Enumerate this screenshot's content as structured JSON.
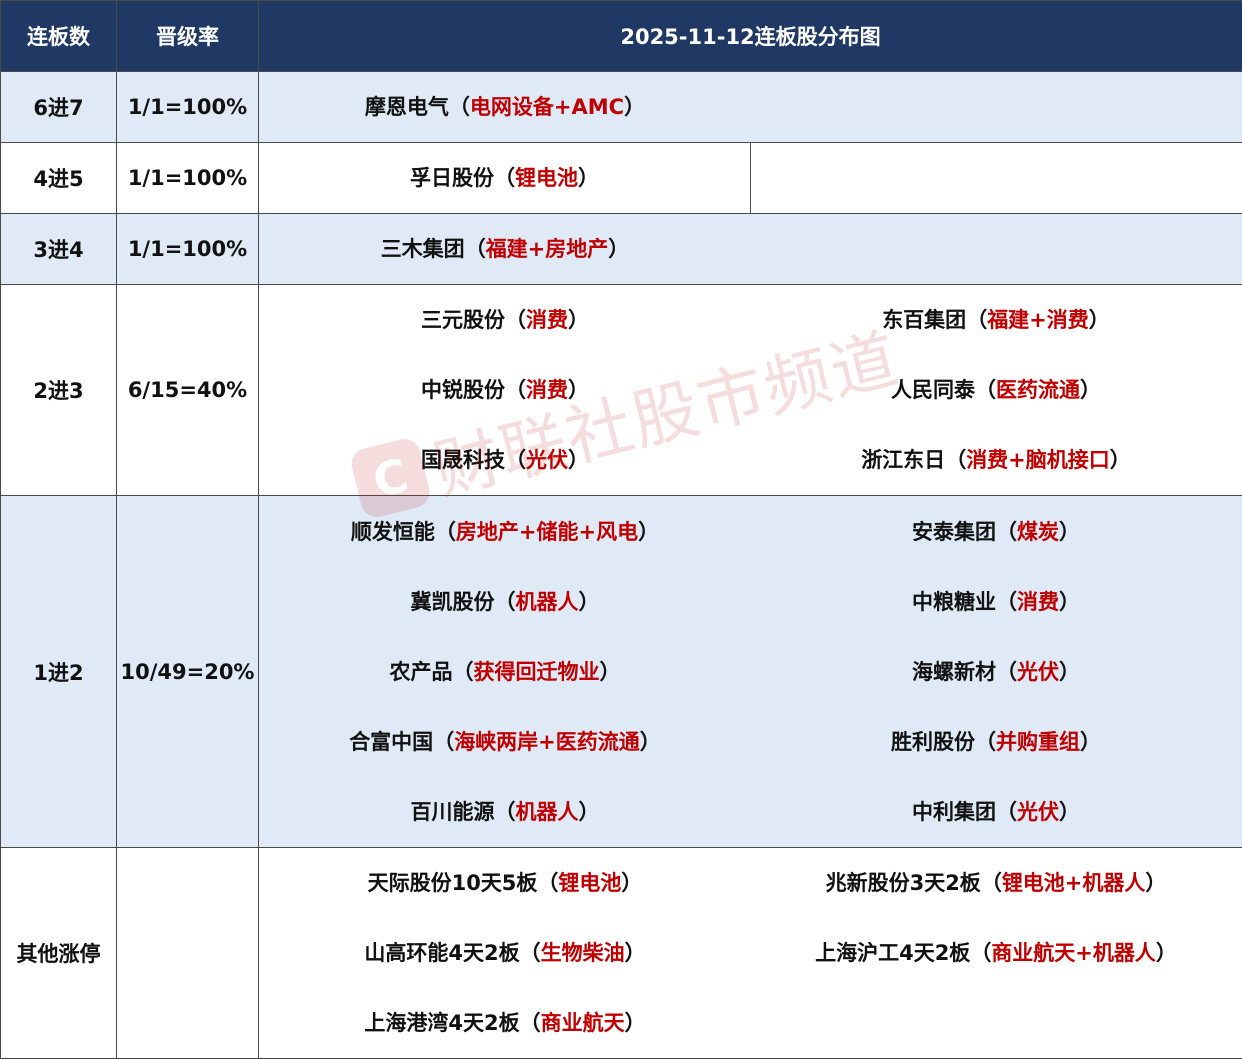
{
  "header": {
    "col_level": "连板数",
    "col_rate": "晋级率",
    "title": "2025-11-12连板股分布图"
  },
  "rows": [
    {
      "level": "6进7",
      "rate": "1/1=100%",
      "stocks": [
        {
          "name": "摩恩电气",
          "theme": "电网设备+AMC"
        }
      ]
    },
    {
      "level": "4进5",
      "rate": "1/1=100%",
      "stocks": [
        {
          "name": "孚日股份",
          "theme": "锂电池"
        }
      ]
    },
    {
      "level": "3进4",
      "rate": "1/1=100%",
      "stocks": [
        {
          "name": "三木集团",
          "theme": "福建+房地产"
        }
      ]
    },
    {
      "level": "2进3",
      "rate": "6/15=40%",
      "stocks": [
        {
          "name": "三元股份",
          "theme": "消费"
        },
        {
          "name": "东百集团",
          "theme": "福建+消费"
        },
        {
          "name": "中锐股份",
          "theme": "消费"
        },
        {
          "name": "人民同泰",
          "theme": "医药流通"
        },
        {
          "name": "国晟科技",
          "theme": "光伏"
        },
        {
          "name": "浙江东日",
          "theme": "消费+脑机接口"
        }
      ]
    },
    {
      "level": "1进2",
      "rate": "10/49=20%",
      "stocks": [
        {
          "name": "顺发恒能",
          "theme": "房地产+储能+风电"
        },
        {
          "name": "安泰集团",
          "theme": "煤炭"
        },
        {
          "name": "冀凯股份",
          "theme": "机器人"
        },
        {
          "name": "中粮糖业",
          "theme": "消费"
        },
        {
          "name": "农产品",
          "theme": "获得回迁物业"
        },
        {
          "name": "海螺新材",
          "theme": "光伏"
        },
        {
          "name": "合富中国",
          "theme": "海峡两岸+医药流通"
        },
        {
          "name": "胜利股份",
          "theme": "并购重组"
        },
        {
          "name": "百川能源",
          "theme": "机器人"
        },
        {
          "name": "中利集团",
          "theme": "光伏"
        }
      ]
    },
    {
      "level": "其他涨停",
      "rate": "",
      "stocks": [
        {
          "name": "天际股份10天5板",
          "theme": "锂电池"
        },
        {
          "name": "兆新股份3天2板",
          "theme": "锂电池+机器人"
        },
        {
          "name": "山高环能4天2板",
          "theme": "生物柴油"
        },
        {
          "name": "上海沪工4天2板",
          "theme": "商业航天+机器人"
        },
        {
          "name": "上海港湾4天2板",
          "theme": "商业航天"
        }
      ]
    }
  ],
  "watermark": {
    "logo": "C",
    "text": "财联社股市频道"
  },
  "colors": {
    "header_bg": "#1f3864",
    "shade_bg": "#dfeaf6",
    "theme_text": "#c00000"
  }
}
